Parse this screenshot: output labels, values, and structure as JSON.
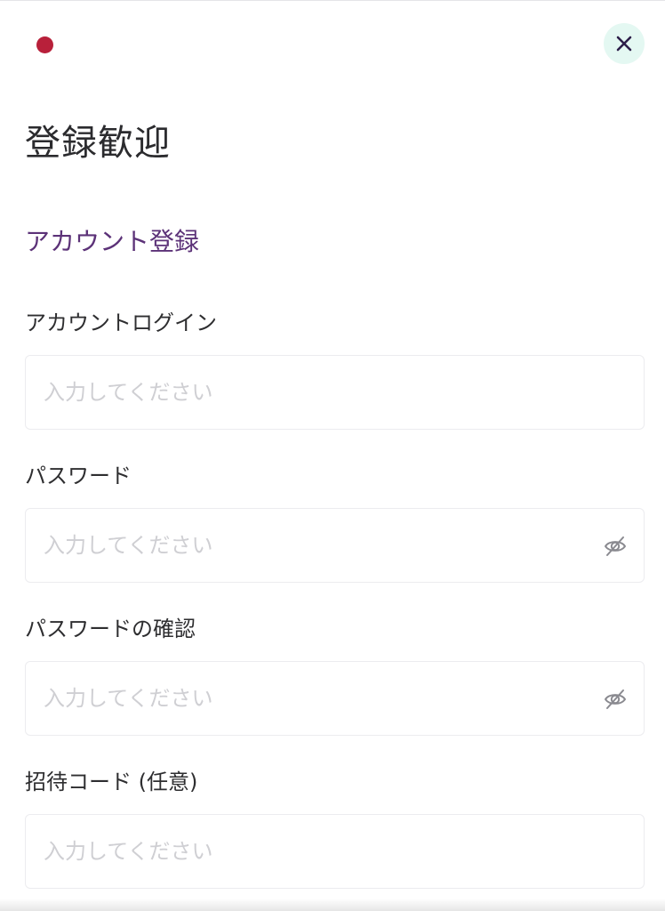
{
  "header": {
    "flag_icon": "red-dot-flag-icon",
    "flag_color": "#b8203a",
    "close_icon": "close-icon"
  },
  "title": "登録歓迎",
  "subtitle": "アカウント登録",
  "colors": {
    "accent": "#5c3278",
    "close_bg": "#e4f8f2",
    "placeholder": "#cfcfd3"
  },
  "form": {
    "account": {
      "label": "アカウントログイン",
      "placeholder": "入力してください",
      "value": ""
    },
    "password": {
      "label": "パスワード",
      "placeholder": "入力してください",
      "value": "",
      "toggle_icon": "eye-off-icon"
    },
    "password_confirm": {
      "label": "パスワードの確認",
      "placeholder": "入力してください",
      "value": "",
      "toggle_icon": "eye-off-icon"
    },
    "invite_code": {
      "label": "招待コード (任意)",
      "placeholder": "入力してください",
      "value": ""
    }
  }
}
